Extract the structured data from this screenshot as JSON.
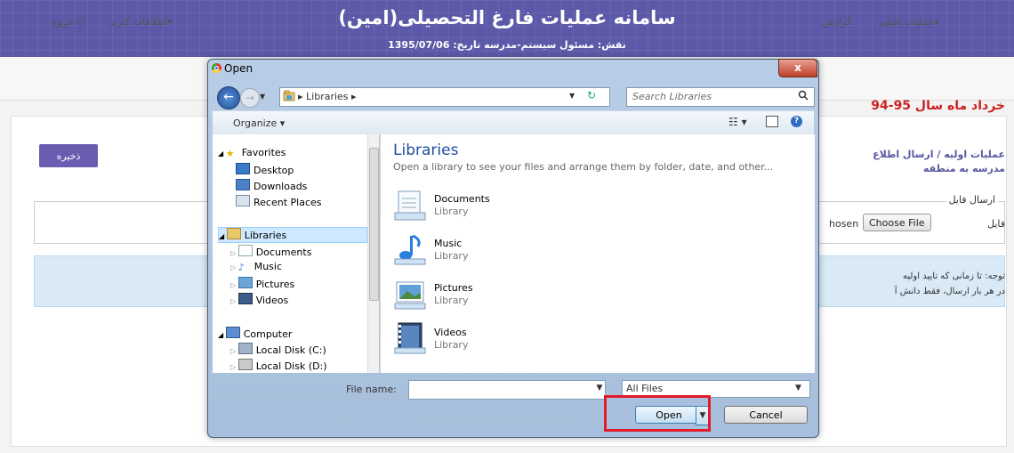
{
  "site": {
    "title": "سامانه عملیات فارغ التحصیلی(امین)",
    "subtitle": "نقش: مسئول سیستم-مدرسه   تاریخ: 1395/07/06"
  },
  "nav": {
    "exit": "خروج",
    "user_info": "اطلاعات کاربر",
    "main_ops": "عملیات اصلی",
    "reports": "گزارش"
  },
  "page": {
    "red_title": "خرداد ماه سال 95-94",
    "save_label": "ذخیره",
    "breadcrumb_line1": "عملیات اولیه / ارسال اطلاع",
    "breadcrumb_line2": "مدرسه به منطقه",
    "fieldset_legend": "ارسال فایل",
    "file_label": "فایل",
    "choose_file": "Choose File",
    "no_file": "hosen",
    "note_line1": "توجه: تا زمانی که تایید اولیه",
    "note_line2": "در هر بار ارسال، فقط دانش آ"
  },
  "dialog": {
    "title": "Open",
    "close": "x",
    "address": "Libraries",
    "search_placeholder": "Search Libraries",
    "organize": "Organize",
    "tree": {
      "favorites": "Favorites",
      "desktop": "Desktop",
      "downloads": "Downloads",
      "recent": "Recent Places",
      "libraries": "Libraries",
      "documents": "Documents",
      "music": "Music",
      "pictures": "Pictures",
      "videos": "Videos",
      "computer": "Computer",
      "disk_c": "Local Disk (C:)",
      "disk_d": "Local Disk (D:)"
    },
    "heading": "Libraries",
    "description": "Open a library to see your files and arrange them by folder, date, and other...",
    "items": [
      {
        "name": "Documents",
        "type": "Library"
      },
      {
        "name": "Music",
        "type": "Library"
      },
      {
        "name": "Pictures",
        "type": "Library"
      },
      {
        "name": "Videos",
        "type": "Library"
      }
    ],
    "filename_label": "File name:",
    "filename_value": "",
    "filter": "All Files",
    "open": "Open",
    "cancel": "Cancel"
  },
  "colors": {
    "banner": "#5c5aa8",
    "highlight": "#e21a2a",
    "red_title": "#cc2222"
  }
}
